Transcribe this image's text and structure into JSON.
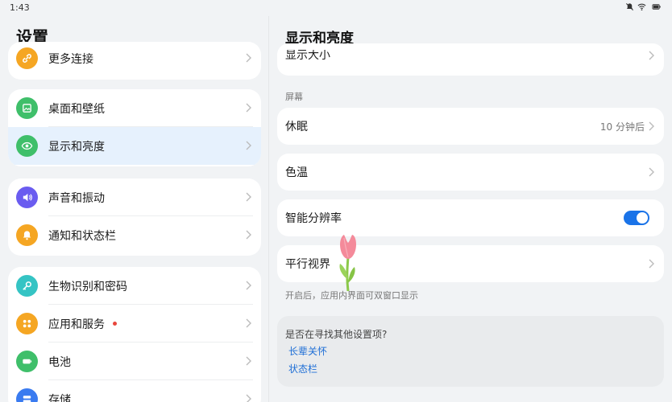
{
  "status_bar": {
    "time": "1:43",
    "icons": [
      "bell-off-icon",
      "wifi-icon",
      "battery-icon"
    ]
  },
  "left": {
    "title": "设置",
    "groups": [
      {
        "items": [
          {
            "label": "更多连接",
            "icon": "link-icon",
            "icon_color": "#f5a623"
          }
        ]
      },
      {
        "items": [
          {
            "label": "桌面和壁纸",
            "icon": "wallpaper-icon",
            "icon_color": "#3fbf6a"
          },
          {
            "label": "显示和亮度",
            "icon": "eye-icon",
            "icon_color": "#3fbf6a",
            "selected": true
          }
        ]
      },
      {
        "items": [
          {
            "label": "声音和振动",
            "icon": "speaker-icon",
            "icon_color": "#6a5cf0"
          },
          {
            "label": "通知和状态栏",
            "icon": "bell-icon",
            "icon_color": "#f5a623"
          }
        ]
      },
      {
        "items": [
          {
            "label": "生物识别和密码",
            "icon": "key-icon",
            "icon_color": "#35c4c4"
          },
          {
            "label": "应用和服务",
            "icon": "apps-icon",
            "icon_color": "#f5a623",
            "badge": true
          },
          {
            "label": "电池",
            "icon": "battery-icon",
            "icon_color": "#3fbf6a"
          },
          {
            "label": "存储",
            "icon": "storage-icon",
            "icon_color": "#3a7bf0"
          }
        ]
      }
    ]
  },
  "right": {
    "title": "显示和亮度",
    "partial_item": "显示大小",
    "section_screen": "屏幕",
    "sleep": {
      "label": "休眠",
      "value": "10 分钟后"
    },
    "color_temp": {
      "label": "色温"
    },
    "smart_resolution": {
      "label": "智能分辨率",
      "enabled": true
    },
    "parallel_view": {
      "label": "平行视界",
      "hint": "开启后，应用内界面可双窗口显示"
    },
    "suggest": {
      "question": "是否在寻找其他设置项?",
      "links": [
        "长辈关怀",
        "状态栏"
      ]
    }
  },
  "colors": {
    "accent": "#1a73e8",
    "selected_bg": "#e6f1fd",
    "background": "#f1f3f5"
  }
}
